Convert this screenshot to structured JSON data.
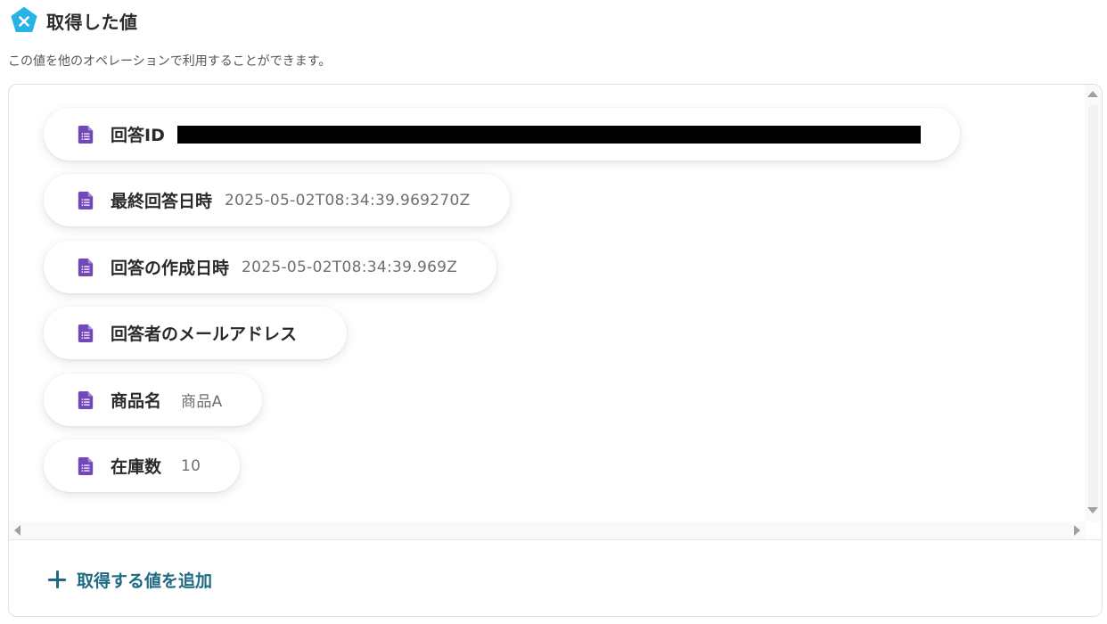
{
  "header": {
    "title": "取得した値",
    "icon": "yoom-pentagon-icon",
    "icon_color": "#27b3e3"
  },
  "subtitle": "この値を他のオペレーションで利用することができます。",
  "items": [
    {
      "label": "回答ID",
      "value": "",
      "redacted": true
    },
    {
      "label": "最終回答日時",
      "value": "2025-05-02T08:34:39.969270Z"
    },
    {
      "label": "回答の作成日時",
      "value": "2025-05-02T08:34:39.969Z"
    },
    {
      "label": "回答者のメールアドレス",
      "value": ""
    },
    {
      "label": "商品名",
      "value": "商品A"
    },
    {
      "label": "在庫数",
      "value": "10"
    }
  ],
  "add_button": {
    "label": "取得する値を追加"
  },
  "colors": {
    "accent": "#1d6a82",
    "doc_icon": "#7248b9",
    "logo": "#27b3e3"
  }
}
